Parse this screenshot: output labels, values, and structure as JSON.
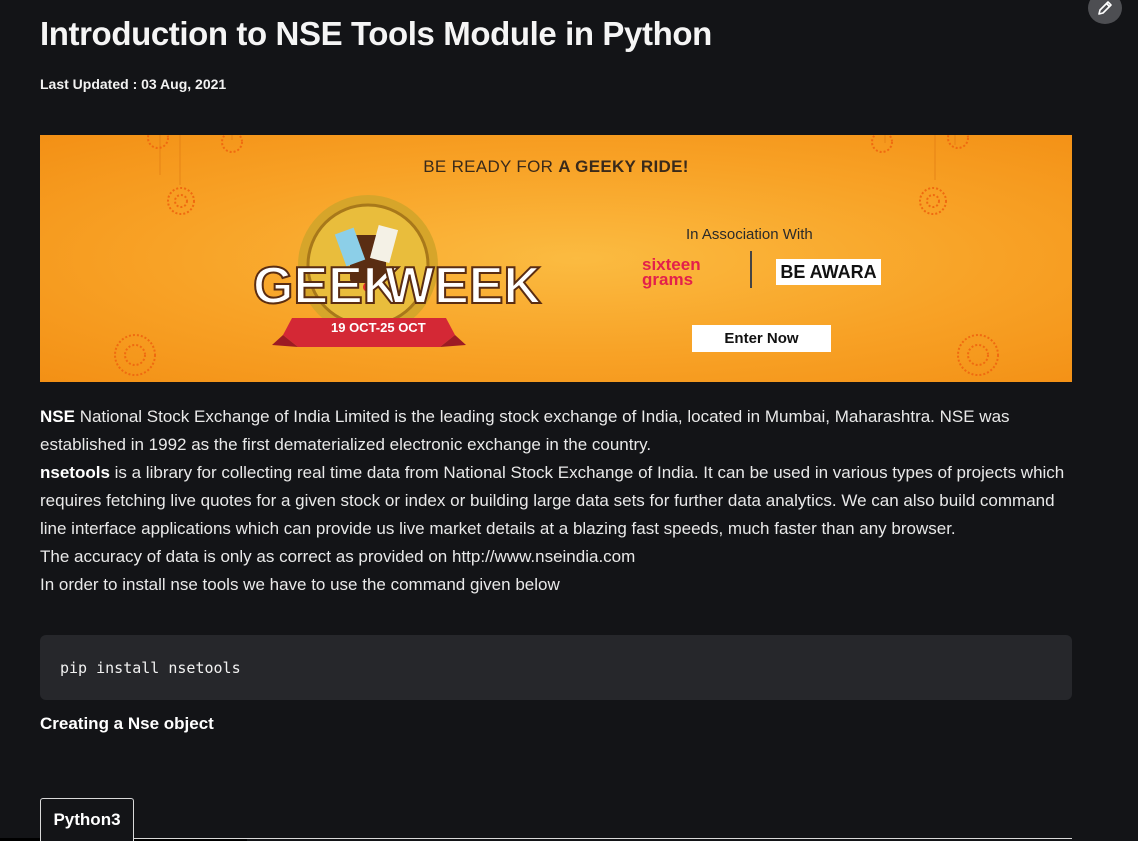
{
  "article": {
    "title": "Introduction to NSE Tools Module in Python",
    "last_updated": "Last Updated : 03 Aug, 2021",
    "p1_bold": "NSE",
    "p1_rest": " National Stock Exchange of India Limited is the leading stock exchange of India, located in Mumbai, Maharashtra. NSE was established in 1992 as the first dematerialized electronic exchange in the country.",
    "p2_bold": "nsetools",
    "p2_rest": " is a library for collecting real time data from National Stock Exchange of India. It can be used in various types of projects which requires fetching live quotes for a given stock or index or building large data sets for further data analytics. We can also build command line interface applications which can provide us live market details at a blazing fast speeds, much faster than any browser.",
    "p3": "The accuracy of data is only as correct as provided on http://www.nseindia.com",
    "p4": "In order to install nse tools we have to use the command given below",
    "code": "pip install nsetools",
    "subheading": "Creating a Nse object",
    "tab_label": "Python3"
  },
  "banner": {
    "headline_pre": "BE READY FOR ",
    "headline_bold": "A GEEKY RIDE!",
    "assoc": "In Association With",
    "partner1_line1": "sixteen",
    "partner1_line2": "grams",
    "partner2": "BE AWARA",
    "cta": "Enter Now",
    "geek_word1": "GEEK",
    "geek_word2": "WEEK",
    "dates": "19 OCT-25 OCT"
  },
  "colors": {
    "background": "#131417",
    "banner_orange": "#f8a226",
    "sixteen_red": "#e3204b"
  },
  "icons": {
    "edit": "pencil-icon"
  }
}
